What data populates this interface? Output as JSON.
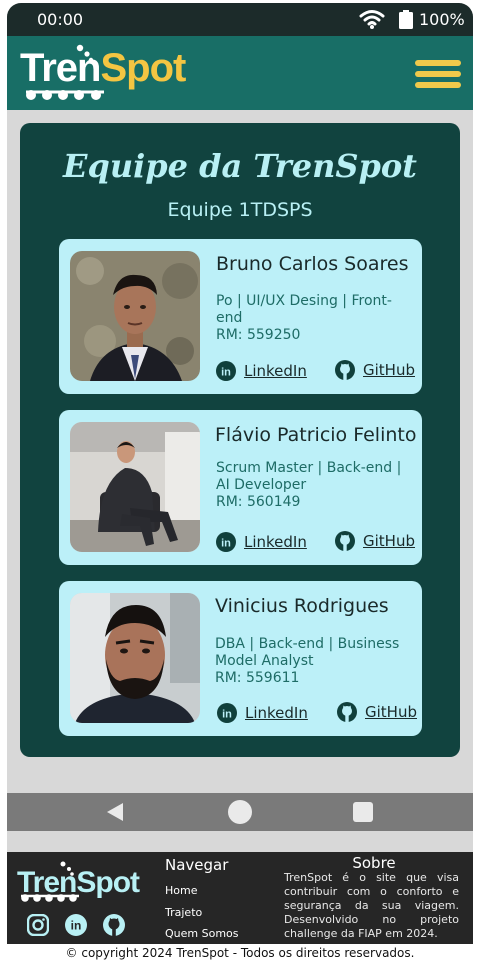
{
  "status_bar": {
    "time": "00:00",
    "battery": "100%"
  },
  "header": {
    "logo_part1": "Tren",
    "logo_part2": "Spot"
  },
  "team": {
    "title": "Equipe da TrenSpot",
    "subtitle": "Equipe 1TDSPS",
    "members": [
      {
        "name": "Bruno Carlos Soares",
        "role": "Po | UI/UX Desing | Front-end",
        "rm": "RM: 559250",
        "linkedin": "LinkedIn",
        "github": "GitHub"
      },
      {
        "name": "Flávio Patricio Felinto",
        "role": "Scrum Master | Back-end | AI Developer",
        "rm": "RM: 560149",
        "linkedin": "LinkedIn",
        "github": "GitHub"
      },
      {
        "name": "Vinicius Rodrigues",
        "role": "DBA | Back-end | Business Model Analyst",
        "rm": "RM: 559611",
        "linkedin": "LinkedIn",
        "github": "GitHub"
      }
    ]
  },
  "footer": {
    "logo_part1": "Tren",
    "logo_part2": "Spot",
    "nav_title": "Navegar",
    "nav_links": [
      "Home",
      "Trajeto",
      "Quem Somos"
    ],
    "about_title": "Sobre",
    "about_text": "TrenSpot é o site que visa contribuir com o conforto e segurança da sua viagem. Desenvolvido no projeto challenge da FIAP em 2024.",
    "copyright": "© copyright 2024 TrenSpot - Todos os direitos reservados."
  },
  "colors": {
    "header": "#186e66",
    "accent": "#f4c542",
    "team_bg": "#11433f",
    "card_bg": "#bcf0f8"
  }
}
